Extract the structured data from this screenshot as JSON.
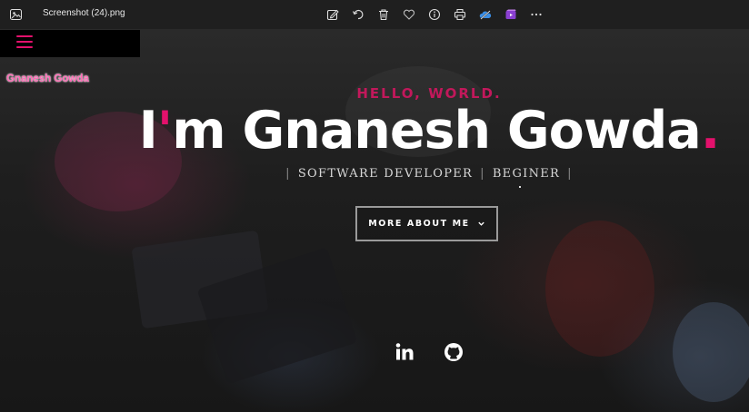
{
  "viewer": {
    "filename": "Screenshot (24).png",
    "toolbar_icons": [
      "edit-icon",
      "rotate-icon",
      "delete-icon",
      "favorite-icon",
      "info-icon",
      "print-icon",
      "onedrive-icon",
      "video-editor-icon",
      "more-icon"
    ]
  },
  "site": {
    "brand": "Gnanesh Gowda",
    "accent_color": "#e3116c",
    "hero": {
      "greeting": "HELLO, WORLD.",
      "headline_prefix": "I",
      "headline_tick": "'",
      "headline_rest": "m Gnanesh Gowda",
      "headline_dot": ".",
      "role_1": "SOFTWARE DEVELOPER",
      "role_2": "BEGINER",
      "separator": "|",
      "cta_label": "MORE ABOUT ME"
    },
    "social_icons": [
      "linkedin-icon",
      "github-icon"
    ]
  }
}
